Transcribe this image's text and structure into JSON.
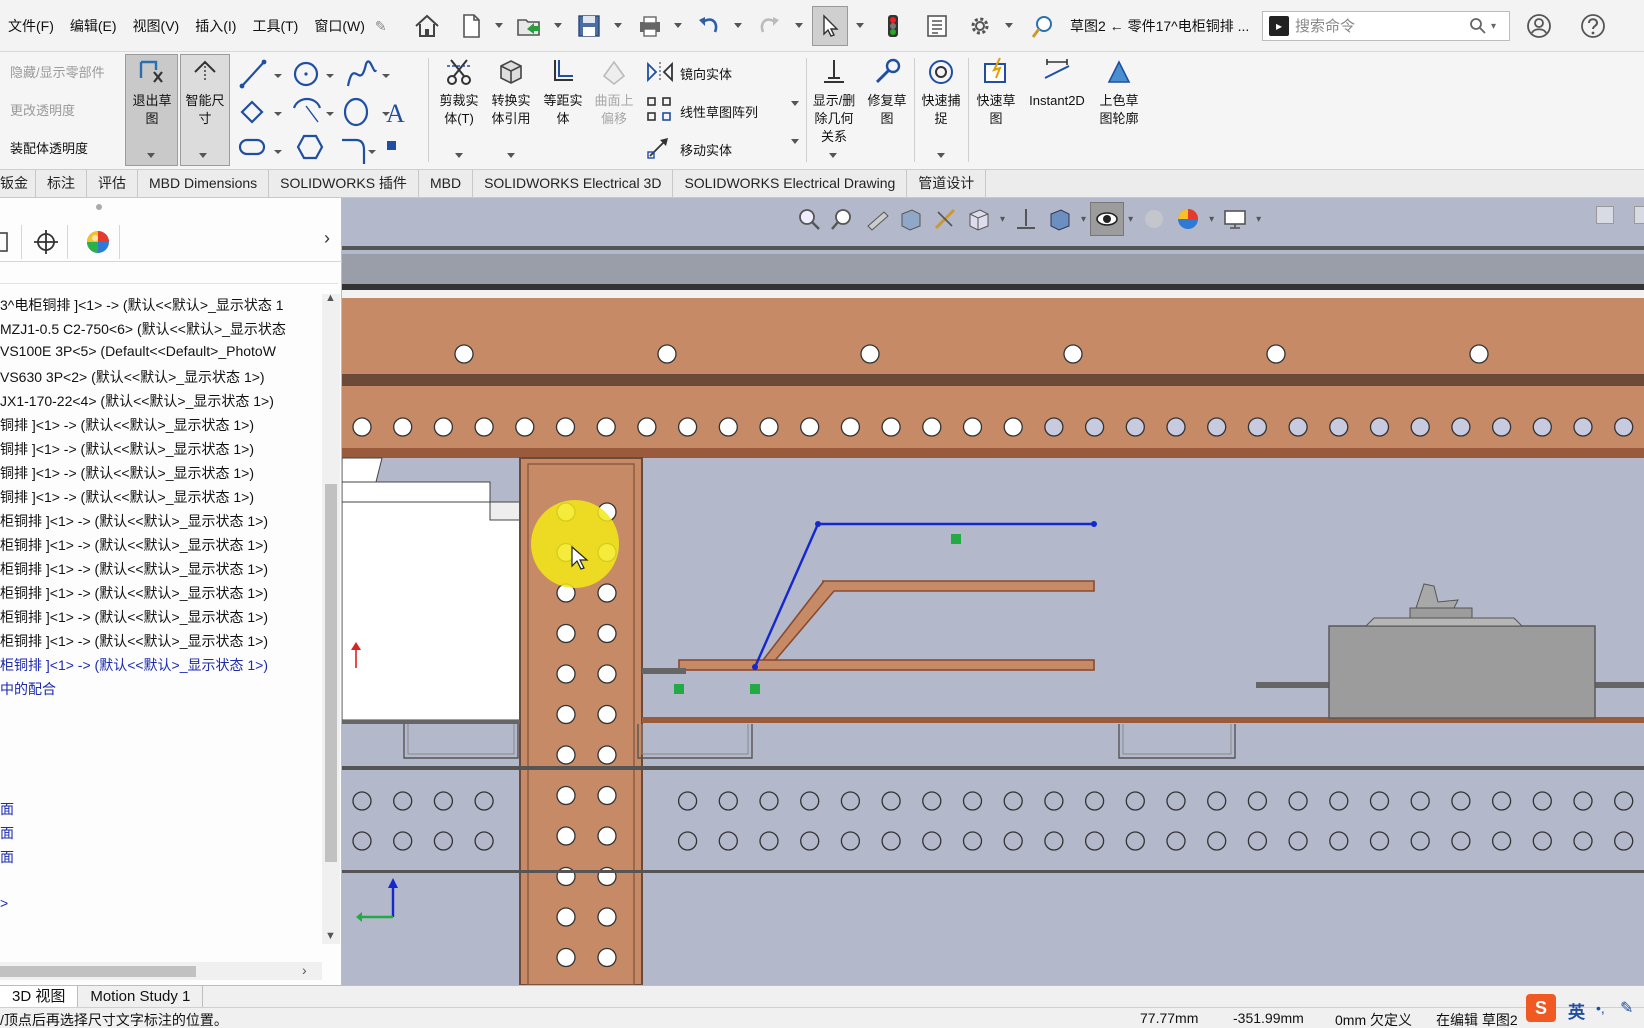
{
  "menu": [
    "文件(F)",
    "编辑(E)",
    "视图(V)",
    "插入(I)",
    "工具(T)",
    "窗口(W)"
  ],
  "document_title": "草图2 ← 零件17^电柜铜排 ...",
  "search": {
    "placeholder": "搜索命令"
  },
  "ribbon": {
    "assembly_left": [
      "隐藏/显示零部件",
      "更改透明度",
      "装配体透明度"
    ],
    "exit_sketch": "退出草图",
    "smart_dimension": "智能尺寸",
    "trim": "剪裁实体(T)",
    "convert": "转换实体引用",
    "offset": "等距实体",
    "offset_on_surface": "曲面上偏移",
    "mirror": "镜向实体",
    "linear_pattern": "线性草图阵列",
    "move": "移动实体",
    "display_relations": "显示/删除几何关系",
    "repair_sketch": "修复草图",
    "quick_snaps": "快速捕捉",
    "rapid_sketch": "快速草图",
    "instant2d": "Instant2D",
    "shaded_contours": "上色草图轮廓"
  },
  "tabs": [
    "钣金",
    "标注",
    "评估",
    "MBD Dimensions",
    "SOLIDWORKS 插件",
    "MBD",
    "SOLIDWORKS Electrical 3D",
    "SOLIDWORKS Electrical Drawing",
    "管道设计"
  ],
  "tree": {
    "items": [
      {
        "text": "3^电柜铜排 ]<1> -> (默认<<默认>_显示状态 1",
        "color": "black"
      },
      {
        "text": "MZJ1-0.5 C2-750<6> (默认<<默认>_显示状态",
        "color": "black"
      },
      {
        "text": "VS100E 3P<5> (Default<<Default>_PhotoW",
        "color": "black"
      },
      {
        "text": "VS630 3P<2> (默认<<默认>_显示状态 1>)",
        "color": "black"
      },
      {
        "text": "JX1-170-22<4> (默认<<默认>_显示状态 1>)",
        "color": "black"
      },
      {
        "text": "铜排 ]<1> -> (默认<<默认>_显示状态 1>)",
        "color": "black"
      },
      {
        "text": "铜排 ]<1> -> (默认<<默认>_显示状态 1>)",
        "color": "black"
      },
      {
        "text": "铜排 ]<1> -> (默认<<默认>_显示状态 1>)",
        "color": "black"
      },
      {
        "text": "铜排 ]<1> -> (默认<<默认>_显示状态 1>)",
        "color": "black"
      },
      {
        "text": "柜铜排 ]<1> -> (默认<<默认>_显示状态 1>)",
        "color": "black"
      },
      {
        "text": "柜铜排 ]<1> -> (默认<<默认>_显示状态 1>)",
        "color": "black"
      },
      {
        "text": "柜铜排 ]<1> -> (默认<<默认>_显示状态 1>)",
        "color": "black"
      },
      {
        "text": "柜铜排 ]<1> -> (默认<<默认>_显示状态 1>)",
        "color": "black"
      },
      {
        "text": "柜铜排 ]<1> -> (默认<<默认>_显示状态 1>)",
        "color": "black"
      },
      {
        "text": "柜铜排 ]<1> -> (默认<<默认>_显示状态 1>)",
        "color": "black"
      },
      {
        "text": "柜铜排 ]<1> -> (默认<<默认>_显示状态 1>)",
        "color": "blue"
      },
      {
        "text": "中的配合",
        "color": "blue"
      }
    ],
    "planes": [
      "面",
      "面",
      "面"
    ],
    "origin": ">"
  },
  "bottom_tabs": [
    "3D 视图",
    "Motion Study 1"
  ],
  "status": {
    "hint": "/顶点后再选择尺寸文字标注的位置。",
    "x": "77.77mm",
    "y": "-351.99mm",
    "z_def": "0mm 欠定义",
    "editing": "在编辑 草图2",
    "ime": "英"
  },
  "colors": {
    "viewport_bg": "#b4b8cb",
    "copper": "#c68a66",
    "copper_dark": "#9a5a3c",
    "sketch_line": "#1428cc",
    "relation_marker": "#22aa44",
    "cursor_highlight": "#f2e818"
  }
}
